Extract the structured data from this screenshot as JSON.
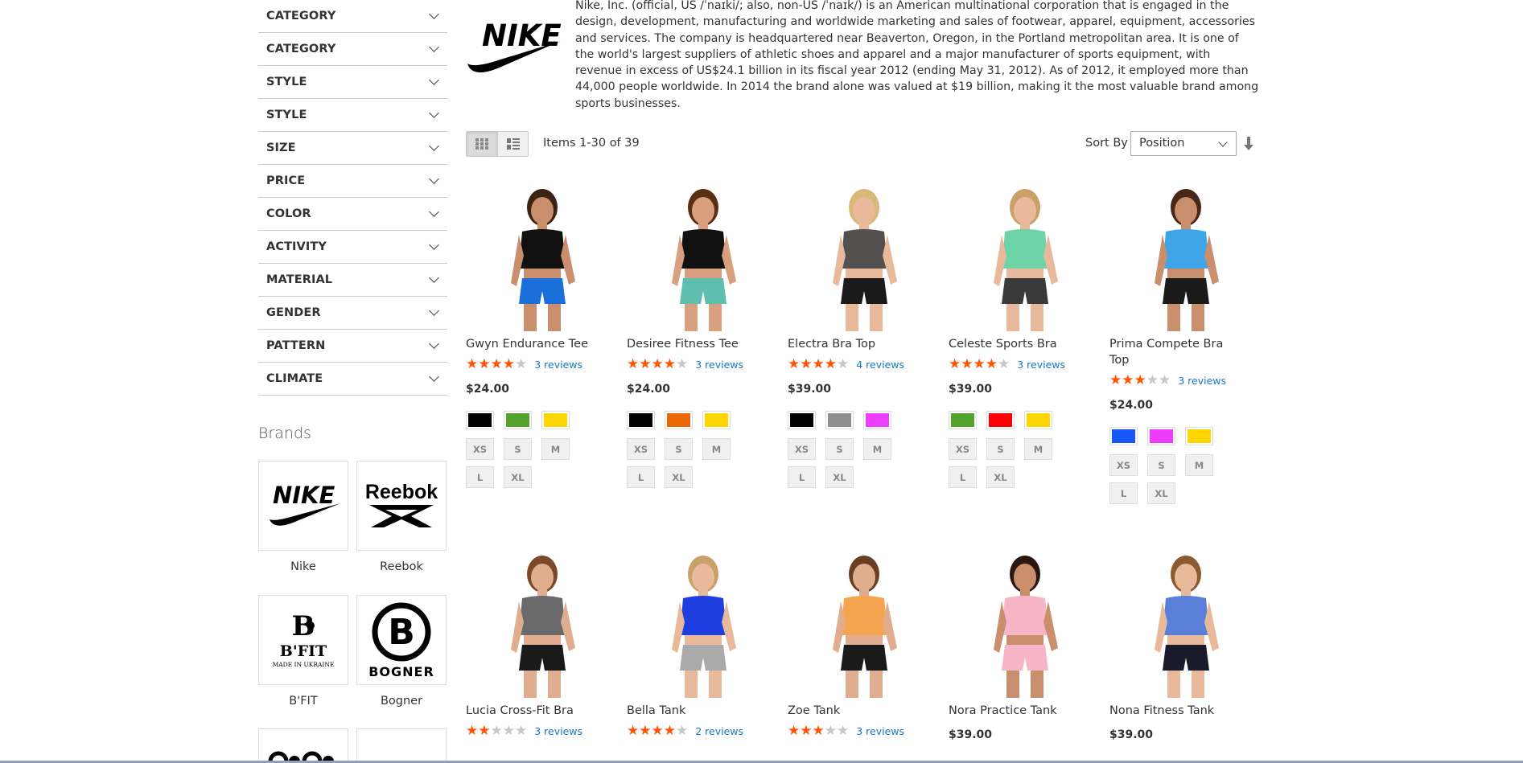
{
  "filters": [
    "CATEGORY",
    "CATEGORY",
    "STYLE",
    "STYLE",
    "SIZE",
    "PRICE",
    "COLOR",
    "ACTIVITY",
    "MATERIAL",
    "GENDER",
    "PATTERN",
    "CLIMATE"
  ],
  "brands": {
    "title": "Brands",
    "items": [
      {
        "name": "Nike",
        "logo_text": "NIKE"
      },
      {
        "name": "Reebok",
        "logo_text": "Reebok"
      },
      {
        "name": "B'FIT",
        "logo_text": "B'FIT",
        "logo_sub": "MADE IN UKRAINE"
      },
      {
        "name": "Bogner",
        "logo_text": "BOGNER"
      }
    ]
  },
  "description": {
    "logo_text": "NIKE",
    "text": "Nike, Inc. (official, US /ˈnaɪki/; also, non-US /ˈnaɪk/) is an American multinational corporation that is engaged in the design, development, manufacturing and worldwide marketing and sales of footwear, apparel, equipment, accessories and services. The company is headquartered near Beaverton, Oregon, in the Portland metropolitan area. It is one of the world's largest suppliers of athletic shoes and apparel and a major manufacturer of sports equipment, with revenue in excess of US$24.1 billion in its fiscal year 2012 (ending May 31, 2012). As of 2012, it employed more than 44,000 people worldwide. In 2014 the brand alone was valued at $19 billion, making it the most valuable brand among sports businesses."
  },
  "toolbar": {
    "view_modes": [
      "grid-icon",
      "list-icon"
    ],
    "amount": "Items 1-30 of 39",
    "sort_label": "Sort By",
    "sort_value": "Position"
  },
  "products": [
    {
      "name": "Gwyn Endurance Tee",
      "rating": 4,
      "reviews": "3 reviews",
      "price": "$24.00",
      "swatches": [
        "#000000",
        "#53a22c",
        "#ffd500"
      ],
      "sizes": [
        "XS",
        "S",
        "M",
        "L",
        "XL"
      ],
      "top": {
        "shirt": "#111111",
        "bottom": "#1a6fd8",
        "skin": "#c98e6b",
        "hair": "#3b2314"
      }
    },
    {
      "name": "Desiree Fitness Tee",
      "rating": 3.5,
      "reviews": "3 reviews",
      "price": "$24.00",
      "swatches": [
        "#000000",
        "#eb6703",
        "#ffd500"
      ],
      "sizes": [
        "XS",
        "S",
        "M",
        "L",
        "XL"
      ],
      "top": {
        "shirt": "#111111",
        "bottom": "#5fbfae",
        "skin": "#d9a07f",
        "hair": "#5a2d15"
      }
    },
    {
      "name": "Electra Bra Top",
      "rating": 4,
      "reviews": "4 reviews",
      "price": "$39.00",
      "swatches": [
        "#000000",
        "#8f8f8f",
        "#ef3dff"
      ],
      "sizes": [
        "XS",
        "S",
        "M",
        "L",
        "XL"
      ],
      "top": {
        "shirt": "#555050",
        "bottom": "#1a1a1a",
        "skin": "#e8b99a",
        "hair": "#d8b878"
      }
    },
    {
      "name": "Celeste Sports Bra",
      "rating": 3.5,
      "reviews": "3 reviews",
      "price": "$39.00",
      "swatches": [
        "#53a22c",
        "#ff0000",
        "#ffd500"
      ],
      "sizes": [
        "XS",
        "S",
        "M",
        "L",
        "XL"
      ],
      "top": {
        "shirt": "#6fd3a8",
        "bottom": "#3a3a3a",
        "skin": "#e8b99a",
        "hair": "#c8a068"
      }
    },
    {
      "name": "Prima Compete Bra Top",
      "rating": 3,
      "reviews": "3 reviews",
      "price": "$24.00",
      "swatches": [
        "#1857f7",
        "#ef3dff",
        "#ffd500"
      ],
      "sizes": [
        "XS",
        "S",
        "M",
        "L",
        "XL"
      ],
      "top": {
        "shirt": "#3ea6e8",
        "bottom": "#1a1a1a",
        "skin": "#c98e6b",
        "hair": "#4a2818"
      }
    },
    {
      "name": "Lucia Cross-Fit Bra",
      "rating": 2,
      "reviews": "3 reviews",
      "price": "",
      "swatches": [],
      "sizes": [],
      "top": {
        "shirt": "#6a6a6a",
        "bottom": "#1a1a1a",
        "skin": "#e0ad8e",
        "hair": "#7a4a28"
      }
    },
    {
      "name": "Bella Tank",
      "rating": 4,
      "reviews": "2 reviews",
      "price": "",
      "swatches": [],
      "sizes": [],
      "top": {
        "shirt": "#1f3ee0",
        "bottom": "#aaaaaa",
        "skin": "#e8b99a",
        "hair": "#c8a068"
      }
    },
    {
      "name": "Zoe Tank",
      "rating": 2.5,
      "reviews": "3 reviews",
      "price": "",
      "swatches": [],
      "sizes": [],
      "top": {
        "shirt": "#f5a450",
        "bottom": "#1a1a1a",
        "skin": "#e0ad8e",
        "hair": "#6a3e20"
      }
    },
    {
      "name": "Nora Practice Tank",
      "rating": 0,
      "reviews": "",
      "price": "$39.00",
      "swatches": [],
      "sizes": [],
      "top": {
        "shirt": "#f7b6c8",
        "bottom": "#f7b6c8",
        "skin": "#c98e6b",
        "hair": "#2a1810"
      }
    },
    {
      "name": "Nona Fitness Tank",
      "rating": 0,
      "reviews": "",
      "price": "$39.00",
      "swatches": [],
      "sizes": [],
      "top": {
        "shirt": "#5a7fd8",
        "bottom": "#1a1a2a",
        "skin": "#e8b99a",
        "hair": "#8a5a30"
      }
    }
  ],
  "colors": {
    "star": "#ff5501",
    "link": "#1979c3"
  }
}
